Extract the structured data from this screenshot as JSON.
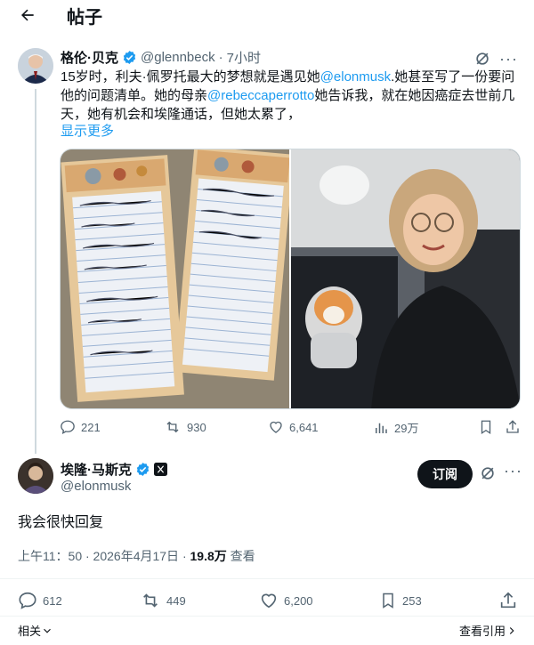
{
  "header": {
    "back_icon": "arrow-left-icon",
    "title": "帖子"
  },
  "quoted_post": {
    "author_name": "格伦·贝克",
    "handle": "@glennbeck",
    "separator": "·",
    "time": "7小时",
    "text_part1": "15岁时，利夫·佩罗托最大的梦想就是遇见她",
    "mention1": "@elonmusk",
    "text_part2": ".她甚至写了一份要问他的问题清单。她的母亲",
    "mention2": "@rebeccaperrotto",
    "text_part3": "她告诉我，就在她因癌症去世前几天，她有机会和埃隆通话，但她太累了，",
    "show_more": "显示更多",
    "stats": {
      "replies": "221",
      "reposts": "930",
      "likes": "6,641",
      "views": "29万"
    }
  },
  "reply_post": {
    "author_name": "埃隆·马斯克",
    "handle": "@elonmusk",
    "subscribe_label": "订阅",
    "text": "我会很快回复",
    "time": "上午11：50 · 2026年4月17日 · ",
    "views_count": "19.8万",
    "views_label": " 查看",
    "stats": {
      "replies": "612",
      "reposts": "449",
      "likes": "6,200",
      "bookmarks": "253"
    }
  },
  "footer": {
    "related": "相关",
    "view_quotes": "查看引用"
  },
  "colors": {
    "accent": "#1d9bf0",
    "text": "#0f1419",
    "secondary": "#536471"
  }
}
